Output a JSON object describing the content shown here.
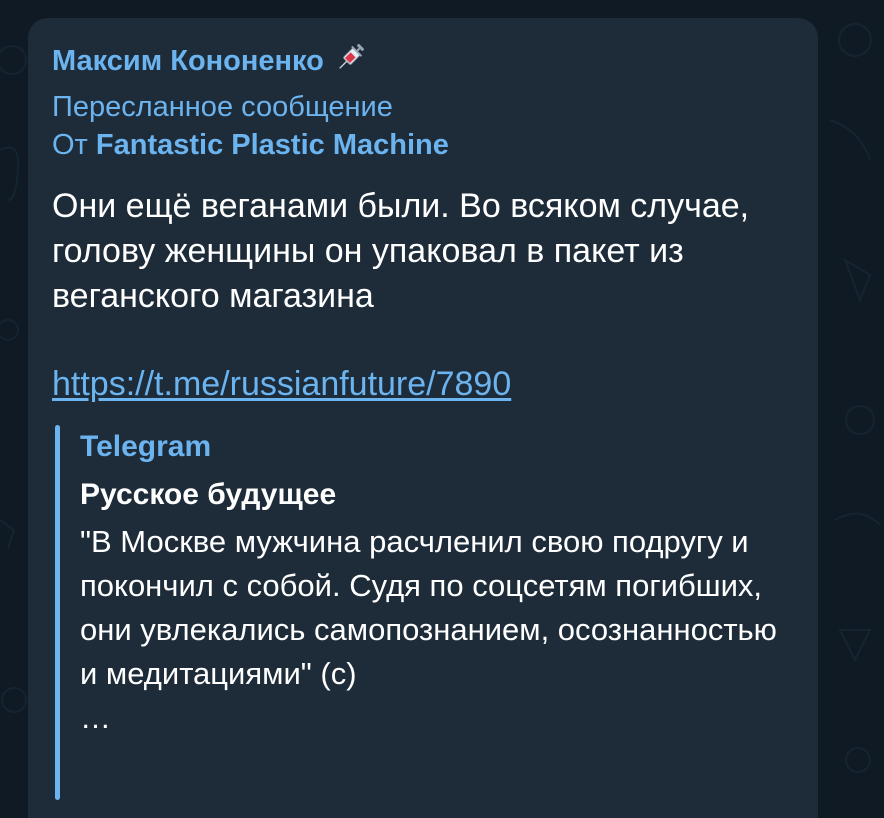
{
  "message": {
    "sender_name": "Максим Кононенко",
    "sender_emoji": "syringe-icon",
    "forwarded_label": "Пересланное сообщение",
    "forwarded_from_prefix": "От",
    "forwarded_from_name": "Fantastic Plastic Machine",
    "text": "Они ещё веганами были. Во всяком случае, голову женщины он упаковал в пакет из веганского магазина",
    "link": "https://t.me/russianfuture/7890"
  },
  "link_preview": {
    "site_name": "Telegram",
    "title": "Русское будущее",
    "description": "\"В Москве мужчина расчленил свою подругу и покончил с собой. Судя по соцсетям погибших, они увлекались самопознанием, осознанностью и медитациями\" (с)",
    "ellipsis": "…"
  },
  "colors": {
    "background": "#0f1a24",
    "bubble": "#1e2c3a",
    "accent": "#6cb4ef",
    "text": "#ffffff"
  }
}
